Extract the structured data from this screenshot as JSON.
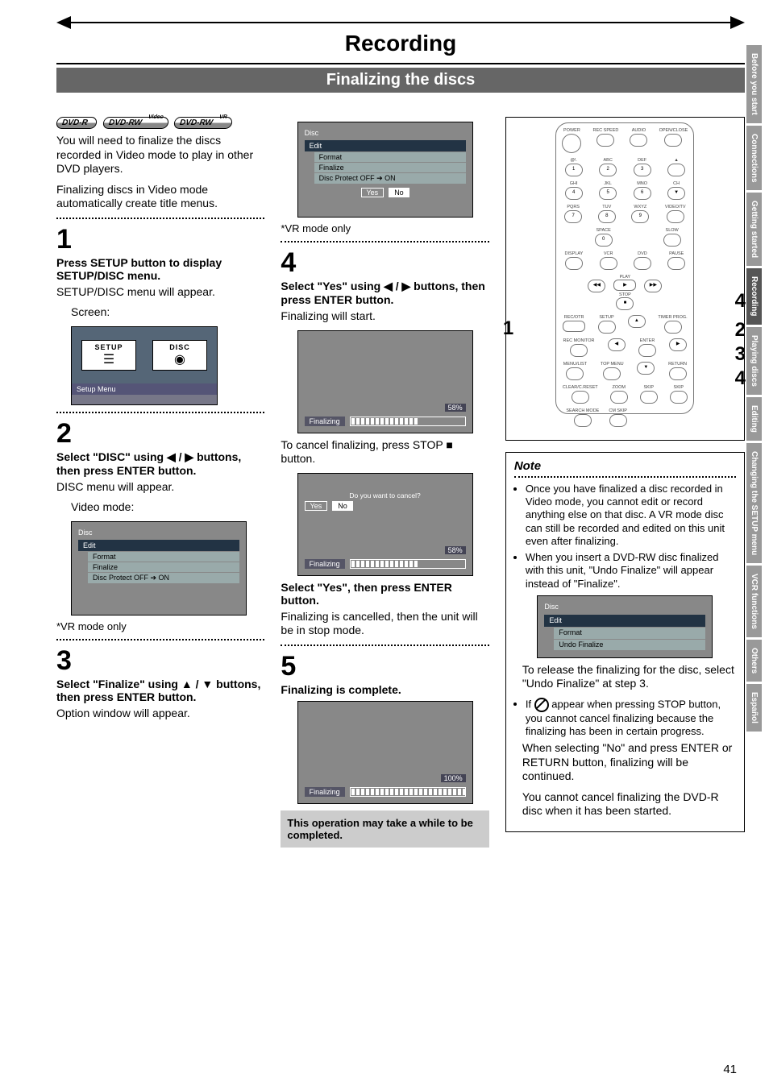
{
  "header": {
    "title": "Recording",
    "subtitle": "Finalizing the discs"
  },
  "side_tabs": [
    "Before you start",
    "Connections",
    "Getting started",
    "Recording",
    "Playing discs",
    "Editing",
    "Changing the SETUP menu",
    "VCR functions",
    "Others",
    "Español"
  ],
  "active_tab": "Recording",
  "page_number": "41",
  "badges": [
    {
      "main": "DVD-R",
      "top": ""
    },
    {
      "main": "DVD-RW",
      "top": "Video"
    },
    {
      "main": "DVD-RW",
      "top": "VR"
    }
  ],
  "col1": {
    "intro1": "You will need to finalize the discs recorded in Video mode to play in other DVD players.",
    "intro2": "Finalizing discs in Video mode automatically create title menus.",
    "step1_num": "1",
    "step1_title": "Press SETUP button to display SETUP/DISC menu.",
    "step1_line": "SETUP/DISC menu will appear.",
    "step1_label": "Screen:",
    "setup_menu": {
      "setup": "SETUP",
      "disc": "DISC",
      "footer": "Setup Menu"
    },
    "step2_num": "2",
    "step2_title": "Select \"DISC\" using ◀ / ▶ buttons, then press ENTER button.",
    "step2_line": "DISC menu will appear.",
    "step2_label": "Video mode:",
    "disc_menu": {
      "title": "Disc",
      "items": [
        "Edit",
        "Format",
        "Finalize",
        "Disc Protect OFF ➔ ON"
      ]
    },
    "vr_annot": "*VR mode only",
    "step3_num": "3",
    "step3_title": "Select \"Finalize\" using ▲ / ▼ buttons, then press ENTER button.",
    "step3_line": "Option window will appear."
  },
  "col2": {
    "opt_menu": {
      "title": "Disc",
      "items": [
        "Edit",
        "Format",
        "Finalize",
        "Disc Protect OFF ➔ ON"
      ],
      "yes": "Yes",
      "no": "No"
    },
    "vr_annot": "*VR mode only",
    "step4_num": "4",
    "step4_title": "Select \"Yes\" using ◀ / ▶ buttons, then press ENTER button.",
    "step4_line": "Finalizing will start.",
    "prog1": {
      "label": "Finalizing",
      "pct": "58%",
      "fill": 58
    },
    "cancel_line": "To cancel finalizing, press STOP ■ button.",
    "cancel_screen": {
      "q": "Do you want to cancel?",
      "yes": "Yes",
      "no": "No",
      "label": "Finalizing",
      "pct": "58%",
      "fill": 58
    },
    "sel_yes_title": "Select \"Yes\", then press ENTER button.",
    "sel_yes_line": "Finalizing is cancelled, then the unit will be in stop mode.",
    "step5_num": "5",
    "step5_title": "Finalizing is complete.",
    "prog2": {
      "label": "Finalizing",
      "pct": "100%",
      "fill": 100
    },
    "highlight": "This operation may take a while to be completed."
  },
  "col3": {
    "remote_callouts": {
      "left": "1",
      "r1": "4",
      "r2": "2",
      "r3": "3",
      "r4": "4"
    },
    "remote_labels": {
      "row1": [
        "POWER",
        "REC SPEED",
        "AUDIO",
        "OPEN/CLOSE"
      ],
      "nums": [
        "@!.",
        "ABC",
        "DEF",
        "GHI",
        "JKL",
        "MNO",
        "PQRS",
        "TUV",
        "WXYZ",
        "SPACE"
      ],
      "digits": [
        "1",
        "2",
        "3",
        "4",
        "5",
        "6",
        "7",
        "8",
        "9",
        "0"
      ],
      "side": [
        "CH",
        "VIDEO/TV",
        "SLOW"
      ],
      "row3": [
        "DISPLAY",
        "VCR",
        "DVD",
        "PAUSE"
      ],
      "play": "PLAY",
      "stop": "STOP",
      "row4": [
        "REC/OTR",
        "SETUP",
        "",
        "TIMER PROG."
      ],
      "enter": "ENTER",
      "row5": [
        "REC MONITOR",
        "",
        "",
        ""
      ],
      "row6": [
        "MENU/LIST",
        "TOP MENU",
        "",
        "RETURN"
      ],
      "row7": [
        "CLEAR/C.RESET",
        "ZOOM",
        "SKIP",
        "SKIP"
      ],
      "row8": [
        "SEARCH MODE",
        "CM SKIP"
      ]
    },
    "note_title": "Note",
    "note1": "Once you have finalized a disc recorded in Video mode, you cannot edit or record anything else on that disc. A VR mode disc can still be recorded and edited on this unit even after finalizing.",
    "note2": "When you insert a DVD-RW disc finalized with this unit, \"Undo Finalize\" will appear instead of \"Finalize\".",
    "undo_menu": {
      "title": "Disc",
      "items": [
        "Edit",
        "Format",
        "Undo Finalize"
      ]
    },
    "note3a": "To release the finalizing for the disc, select \"Undo Finalize\" at step 3.",
    "note3b_pre": "If ",
    "note3b_post": " appear when pressing STOP button, you cannot cancel finalizing because the finalizing has been in certain progress.",
    "note3c": "When selecting \"No\" and press ENTER or RETURN button, finalizing will be continued.",
    "note3d": "You cannot cancel finalizing the DVD-R disc when it has been started."
  }
}
